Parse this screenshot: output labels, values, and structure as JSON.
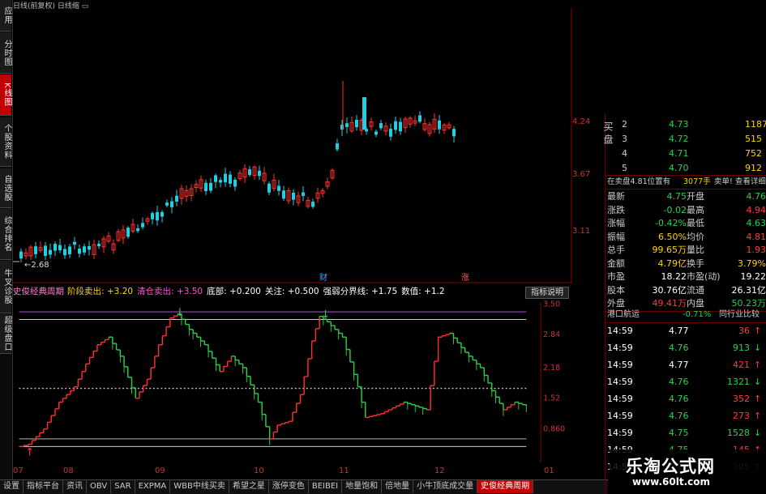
{
  "topbar": {
    "title": "日线(前复权)  日线缩 ▭"
  },
  "leftnav": [
    {
      "label": "应用",
      "active": false
    },
    {
      "label": "分时图",
      "active": false
    },
    {
      "label": "K线图",
      "active": true
    },
    {
      "label": "个股资料",
      "active": false
    },
    {
      "label": "自选股",
      "active": false
    },
    {
      "label": "综合排名",
      "active": false
    },
    {
      "label": "牛叉诊股",
      "active": false
    },
    {
      "label": "超级盘口",
      "active": false
    }
  ],
  "price_axis": [
    "4.24",
    "3.67",
    "3.11"
  ],
  "low_label": "2.68",
  "event_labels": {
    "cai": "财",
    "zhang": "涨"
  },
  "indicator": {
    "name": "史俊经典周期",
    "items": [
      {
        "text": "阶段卖出: +3.20",
        "color": "#ffd200"
      },
      {
        "text": "清仓卖出: +3.50",
        "color": "#ff4fd0"
      },
      {
        "text": "底部: +0.200",
        "color": "#ffffff"
      },
      {
        "text": "关注: +0.500",
        "color": "#ffffff"
      },
      {
        "text": "强弱分界线: +1.75",
        "color": "#ffffff"
      },
      {
        "text": "数值: +1.2",
        "color": "#ffffff"
      }
    ],
    "help_button": "指标说明",
    "axis": [
      "3.50",
      "2.84",
      "2.18",
      "1.52",
      "0.860"
    ]
  },
  "xaxis": [
    "07",
    "08",
    "09",
    "10",
    "11",
    "12",
    "01"
  ],
  "tabs": [
    {
      "label": "设置",
      "active": false
    },
    {
      "label": "指标平台",
      "active": false
    },
    {
      "label": "资讯",
      "active": false
    },
    {
      "label": "OBV",
      "active": false
    },
    {
      "label": "SAR",
      "active": false
    },
    {
      "label": "EXPMA",
      "active": false
    },
    {
      "label": "WBB中线买卖",
      "active": false
    },
    {
      "label": "希望之星",
      "active": false
    },
    {
      "label": "涨停变色",
      "active": false
    },
    {
      "label": "BEIBEI",
      "active": false
    },
    {
      "label": "地量饱和",
      "active": false
    },
    {
      "label": "倍地量",
      "active": false
    },
    {
      "label": "小牛顶底成交量",
      "active": false
    },
    {
      "label": "史俊经典周期",
      "active": true
    }
  ],
  "buy_book": {
    "side_label": "买盘",
    "rows": [
      {
        "level": "2",
        "price": "4.73",
        "vol": "1187"
      },
      {
        "level": "3",
        "price": "4.72",
        "vol": "515"
      },
      {
        "level": "4",
        "price": "4.71",
        "vol": "752"
      },
      {
        "level": "5",
        "price": "4.70",
        "vol": "912"
      }
    ]
  },
  "sell_info": {
    "text1": "在卖盘4.81位置有",
    "text2": "3077手",
    "text3": "卖单! 查看详细"
  },
  "quote": [
    {
      "l1": "最新",
      "v1": "4.75",
      "c1": "grn",
      "l2": "开盘",
      "v2": "4.76",
      "c2": "grn"
    },
    {
      "l1": "涨跌",
      "v1": "-0.02",
      "c1": "grn",
      "l2": "最高",
      "v2": "4.94",
      "c2": "red"
    },
    {
      "l1": "涨幅",
      "v1": "-0.42%",
      "c1": "grn",
      "l2": "最低",
      "v2": "4.63",
      "c2": "grn"
    },
    {
      "l1": "振幅",
      "v1": "6.50%",
      "c1": "yel",
      "l2": "均价",
      "v2": "4.81",
      "c2": "red"
    },
    {
      "l1": "总手",
      "v1": "99.65万",
      "c1": "yel",
      "l2": "量比",
      "v2": "1.93",
      "c2": "red"
    },
    {
      "l1": "金额",
      "v1": "4.79亿",
      "c1": "yel",
      "l2": "换手",
      "v2": "3.79%",
      "c2": "yel"
    },
    {
      "l1": "市盈",
      "v1": "18.22",
      "c1": "wht",
      "l2": "市盈(动)",
      "v2": "19.22",
      "c2": "wht"
    },
    {
      "l1": "股本",
      "v1": "30.76亿",
      "c1": "wht",
      "l2": "流通",
      "v2": "26.31亿",
      "c2": "wht"
    },
    {
      "l1": "外盘",
      "v1": "49.41万",
      "c1": "red",
      "l2": "内盘",
      "v2": "50.23万",
      "c2": "grn"
    }
  ],
  "sector": {
    "name": "港口航运",
    "change": "-0.71%",
    "compare": "同行业比较"
  },
  "ticks": [
    {
      "time": "14:59",
      "price": "4.77",
      "pc": "wht",
      "vol": "36",
      "dir": "up"
    },
    {
      "time": "14:59",
      "price": "4.76",
      "pc": "grn",
      "vol": "913",
      "dir": "down"
    },
    {
      "time": "14:59",
      "price": "4.77",
      "pc": "wht",
      "vol": "421",
      "dir": "up"
    },
    {
      "time": "14:59",
      "price": "4.76",
      "pc": "grn",
      "vol": "1321",
      "dir": "down"
    },
    {
      "time": "14:59",
      "price": "4.76",
      "pc": "grn",
      "vol": "352",
      "dir": "up"
    },
    {
      "time": "14:59",
      "price": "4.76",
      "pc": "grn",
      "vol": "273",
      "dir": "up"
    },
    {
      "time": "14:59",
      "price": "4.75",
      "pc": "grn",
      "vol": "1528",
      "dir": "down"
    },
    {
      "time": "14:59",
      "price": "4.75",
      "pc": "grn",
      "vol": "145",
      "dir": "up"
    },
    {
      "time": "14:59",
      "price": "4.75",
      "pc": "grn",
      "vol": "205",
      "dir": "up"
    }
  ],
  "watermark": {
    "title": "乐淘公式网",
    "url": "www.60lt.com"
  },
  "colors": {
    "up": "#ff3030",
    "down": "#20d0e0",
    "green": "#2ad14a",
    "pink": "#c060ff"
  }
}
